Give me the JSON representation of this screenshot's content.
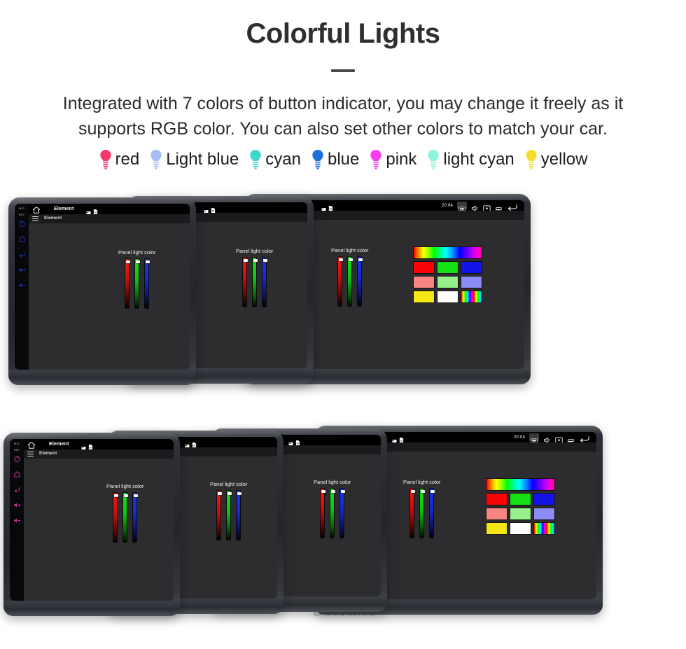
{
  "header": {
    "title": "Colorful Lights",
    "subtitle": "Integrated with 7 colors of button indicator, you may change it freely as it supports RGB color. You can also set other colors to match your car.",
    "divider_color": "#4a4a4d"
  },
  "legend": {
    "items": [
      {
        "label": "red",
        "color": "#f5376b"
      },
      {
        "label": "Light blue",
        "color": "#a8bcf2"
      },
      {
        "label": "cyan",
        "color": "#3ed8d0"
      },
      {
        "label": "blue",
        "color": "#1f6fe0"
      },
      {
        "label": "pink",
        "color": "#f93df0"
      },
      {
        "label": "light cyan",
        "color": "#8ff2dc"
      },
      {
        "label": "yellow",
        "color": "#f5dc33"
      }
    ]
  },
  "device": {
    "status_bar": {
      "title": "Element",
      "clock": "20:04",
      "icons": [
        "home-icon",
        "sd-card-icon",
        "sim-card-icon",
        "screenshot-icon",
        "volume-icon",
        "capture-icon",
        "recents-icon",
        "back-icon"
      ]
    },
    "app_bar": {
      "title": "Element",
      "menu_icon": "hamburger-icon"
    },
    "panel": {
      "label": "Panel light color",
      "sliders": [
        {
          "name": "red",
          "color": "#ff1414",
          "value": 97
        },
        {
          "name": "green",
          "color": "#18e218",
          "value": 97
        },
        {
          "name": "blue",
          "color": "#1d36f0",
          "value": 97
        }
      ]
    },
    "side_buttons": {
      "labels": [
        "MIC",
        "RST"
      ],
      "icons": [
        "power-icon",
        "home-icon",
        "back-icon",
        "volume-up-icon",
        "volume-down-icon"
      ]
    },
    "palette": {
      "swatches": [
        {
          "name": "hue-spectrum",
          "kind": "hue-bar",
          "color": ""
        },
        {
          "name": "red",
          "kind": "solid",
          "color": "#fa0505"
        },
        {
          "name": "green",
          "kind": "solid",
          "color": "#14e014"
        },
        {
          "name": "blue",
          "kind": "solid",
          "color": "#1414e6"
        },
        {
          "name": "salmon",
          "kind": "solid",
          "color": "#fa8683"
        },
        {
          "name": "light-green",
          "kind": "solid",
          "color": "#96f08c"
        },
        {
          "name": "periwinkle",
          "kind": "solid",
          "color": "#8b8cf5"
        },
        {
          "name": "yellow",
          "kind": "solid",
          "color": "#f5e614"
        },
        {
          "name": "white",
          "kind": "solid",
          "color": "#ffffff"
        },
        {
          "name": "rainbow-cycle",
          "kind": "hue-mini",
          "color": ""
        }
      ]
    }
  },
  "rows": [
    {
      "name": "row-one",
      "units": [
        {
          "name": "unit-blue",
          "button_color": "#2036d8",
          "label_color": "#7b7b88",
          "show_palette": false,
          "show_statusbar_right": false
        },
        {
          "name": "unit-green",
          "button_color": "#13c62a",
          "label_color": "#7b7b88",
          "show_palette": false,
          "show_statusbar_right": false
        },
        {
          "name": "unit-blue-palette",
          "button_color": "#2036d8",
          "label_color": "#7b7b88",
          "show_palette": true,
          "show_statusbar_right": true
        }
      ]
    },
    {
      "name": "row-two",
      "units": [
        {
          "name": "unit-pink",
          "button_color": "#d83a9e",
          "label_color": "#7b7b88",
          "show_palette": false,
          "show_statusbar_right": false
        },
        {
          "name": "unit-yellow",
          "button_color": "#e0b81e",
          "label_color": "#7b7b88",
          "show_palette": false,
          "show_statusbar_right": false
        },
        {
          "name": "unit-lightblue",
          "button_color": "#4d79b8",
          "label_color": "#7b7b88",
          "show_palette": false,
          "show_statusbar_right": false
        },
        {
          "name": "unit-green-palette",
          "button_color": "#13c62a",
          "label_color": "#7b7b88",
          "show_palette": true,
          "show_statusbar_right": true
        }
      ]
    }
  ],
  "watermark": {
    "text": "Seicane"
  }
}
